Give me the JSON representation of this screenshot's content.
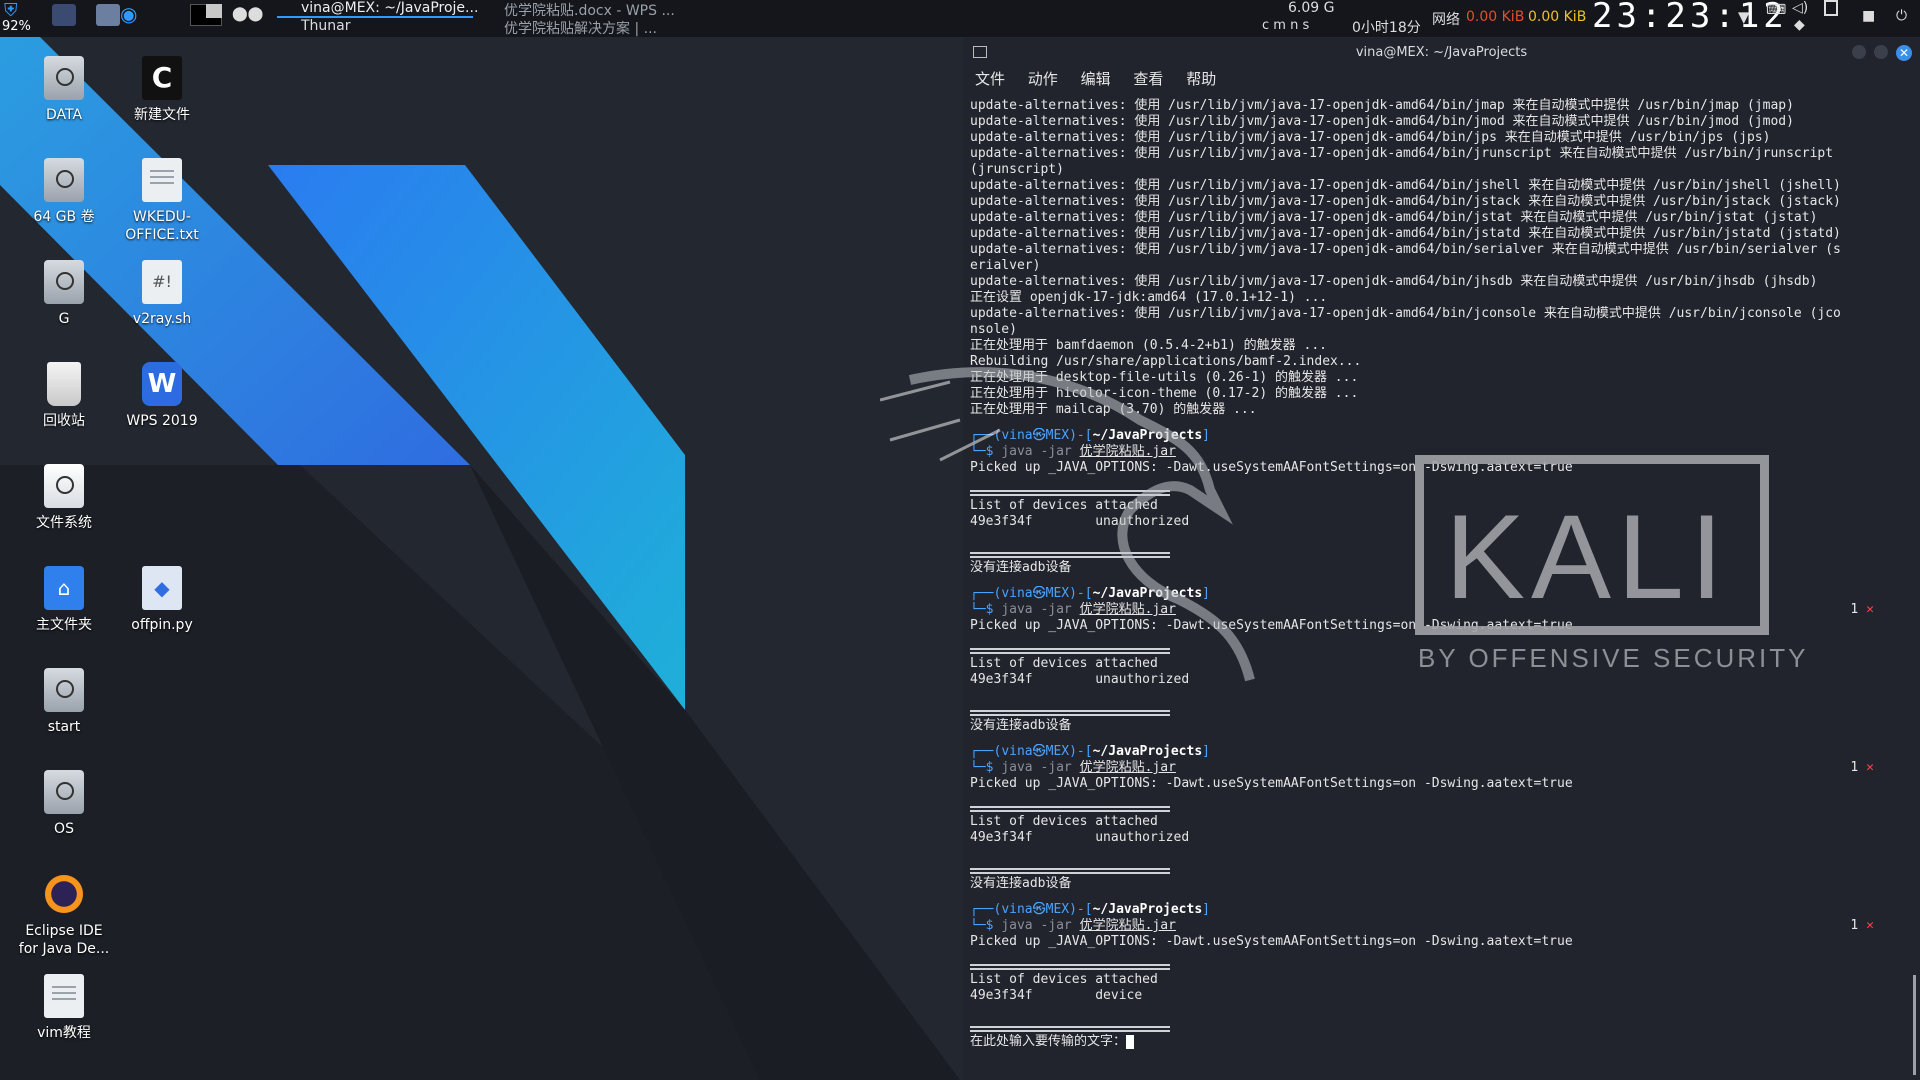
{
  "topbar": {
    "battery": "92%",
    "tasks": [
      {
        "label": "vina@MEX: ~/JavaProje..."
      },
      {
        "label": "Thunar"
      },
      {
        "label": "优学院粘贴.docx - WPS ..."
      },
      {
        "label": "优学院粘贴解决方案 | ..."
      }
    ],
    "mem": "6.09 G",
    "cpu_letters": "c  m  n  s",
    "uptime": "0小时18分",
    "net_label": "网络",
    "net_down": "0.00 KiB",
    "net_up": "0.00 KiB",
    "clock": "23:23:12"
  },
  "desktop": {
    "icons": [
      {
        "label": "DATA"
      },
      {
        "label": "新建文件"
      },
      {
        "label": "64 GB 卷"
      },
      {
        "label": "WKEDU-OFFICE.txt"
      },
      {
        "label": "G"
      },
      {
        "label": "v2ray.sh"
      },
      {
        "label": "回收站"
      },
      {
        "label": "WPS 2019"
      },
      {
        "label": "文件系统"
      },
      {
        "label": "主文件夹"
      },
      {
        "label": "offpin.py"
      },
      {
        "label": "start"
      },
      {
        "label": "OS"
      },
      {
        "label": "Eclipse IDE for Java De..."
      },
      {
        "label": "vim教程"
      }
    ]
  },
  "terminal": {
    "title": "vina@MEX: ~/JavaProjects",
    "menu": [
      "文件",
      "动作",
      "编辑",
      "查看",
      "帮助"
    ],
    "log": [
      "update-alternatives: 使用 /usr/lib/jvm/java-17-openjdk-amd64/bin/jmap 来在自动模式中提供 /usr/bin/jmap (jmap)",
      "update-alternatives: 使用 /usr/lib/jvm/java-17-openjdk-amd64/bin/jmod 来在自动模式中提供 /usr/bin/jmod (jmod)",
      "update-alternatives: 使用 /usr/lib/jvm/java-17-openjdk-amd64/bin/jps 来在自动模式中提供 /usr/bin/jps (jps)",
      "update-alternatives: 使用 /usr/lib/jvm/java-17-openjdk-amd64/bin/jrunscript 来在自动模式中提供 /usr/bin/jrunscript",
      "(jrunscript)",
      "update-alternatives: 使用 /usr/lib/jvm/java-17-openjdk-amd64/bin/jshell 来在自动模式中提供 /usr/bin/jshell (jshell)",
      "update-alternatives: 使用 /usr/lib/jvm/java-17-openjdk-amd64/bin/jstack 来在自动模式中提供 /usr/bin/jstack (jstack)",
      "update-alternatives: 使用 /usr/lib/jvm/java-17-openjdk-amd64/bin/jstat 来在自动模式中提供 /usr/bin/jstat (jstat)",
      "update-alternatives: 使用 /usr/lib/jvm/java-17-openjdk-amd64/bin/jstatd 来在自动模式中提供 /usr/bin/jstatd (jstatd)",
      "update-alternatives: 使用 /usr/lib/jvm/java-17-openjdk-amd64/bin/serialver 来在自动模式中提供 /usr/bin/serialver (s",
      "erialver)",
      "update-alternatives: 使用 /usr/lib/jvm/java-17-openjdk-amd64/bin/jhsdb 来在自动模式中提供 /usr/bin/jhsdb (jhsdb)",
      "正在设置 openjdk-17-jdk:amd64 (17.0.1+12-1) ...",
      "update-alternatives: 使用 /usr/lib/jvm/java-17-openjdk-amd64/bin/jconsole 来在自动模式中提供 /usr/bin/jconsole (jco",
      "nsole)",
      "正在处理用于 bamfdaemon (0.5.4-2+b1) 的触发器 ...",
      "Rebuilding /usr/share/applications/bamf-2.index...",
      "正在处理用于 desktop-file-utils (0.26-1) 的触发器 ...",
      "正在处理用于 hicolor-icon-theme (0.17-2) 的触发器 ...",
      "正在处理用于 mailcap (3.70) 的触发器 ..."
    ],
    "prompt_user": "vina㉿MEX",
    "prompt_dir": "~/JavaProjects",
    "cmd_java": "java -jar",
    "cmd_jar": "优学院粘贴.jar",
    "picked": "Picked up _JAVA_OPTIONS: -Dawt.useSystemAAFontSettings=on -Dswing.aatext=true",
    "devices_header": "List of devices attached",
    "no_adb": "没有连接adb设备",
    "runs": [
      {
        "device_line": "49e3f34f        unauthorized",
        "code": ""
      },
      {
        "device_line": "49e3f34f        unauthorized",
        "code": "1"
      },
      {
        "device_line": "49e3f34f        unauthorized",
        "code": "1"
      },
      {
        "device_line": "49e3f34f        device",
        "code": "1"
      }
    ],
    "input_prompt": "在此处输入要传输的文字："
  },
  "wallpaper": {
    "brand": "KALI",
    "tagline": "BY OFFENSIVE SECURITY"
  }
}
